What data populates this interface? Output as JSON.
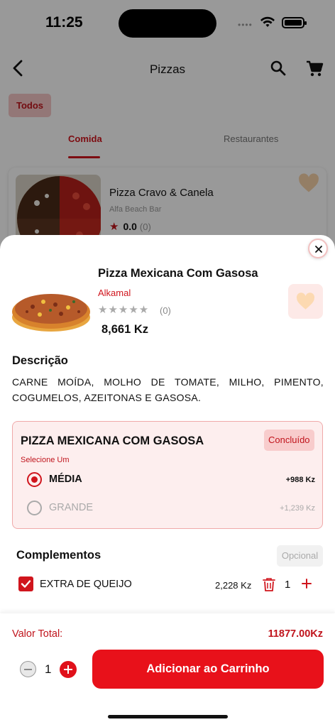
{
  "status": {
    "time": "11:25",
    "signal": "••••"
  },
  "nav": {
    "title": "Pizzas"
  },
  "filters": {
    "chip": "Todos"
  },
  "tabs": [
    {
      "label": "Comida",
      "active": true
    },
    {
      "label": "Restaurantes",
      "active": false
    }
  ],
  "background_card": {
    "name": "Pizza Cravo &  Canela",
    "restaurant": "Alfa Beach Bar",
    "rating": "0.0",
    "rating_count": "(0)"
  },
  "product": {
    "name": "Pizza Mexicana Com Gasosa",
    "restaurant": "Alkamal",
    "stars": "★★★★★",
    "rating_count": "(0)",
    "price": "8,661 Kz"
  },
  "description": {
    "title": "Descrição",
    "text": "CARNE MOÍDA, MOLHO DE TOMATE, MILHO, PIMENTO, COGUMELOS, AZEITONAS E GASOSA."
  },
  "variation": {
    "title": "PIZZA MEXICANA COM GASOSA",
    "badge": "Concluído",
    "subtitle": "Selecione Um",
    "options": [
      {
        "label": "MÉDIA",
        "price": "+988 Kz",
        "selected": true
      },
      {
        "label": "GRANDE",
        "price": "+1,239 Kz",
        "selected": false
      }
    ]
  },
  "addons": {
    "title": "Complementos",
    "badge": "Opcional",
    "items": [
      {
        "label": "EXTRA DE QUEIJO",
        "price": "2,228 Kz",
        "qty": "1",
        "checked": true
      }
    ]
  },
  "footer": {
    "total_label": "Valor Total:",
    "total_value": "11877.00Kz",
    "qty": "1",
    "add_button": "Adicionar ao Carrinho"
  },
  "colors": {
    "accent": "#e8111a",
    "accent_dark": "#c0141c",
    "tint": "#fdeeee"
  }
}
